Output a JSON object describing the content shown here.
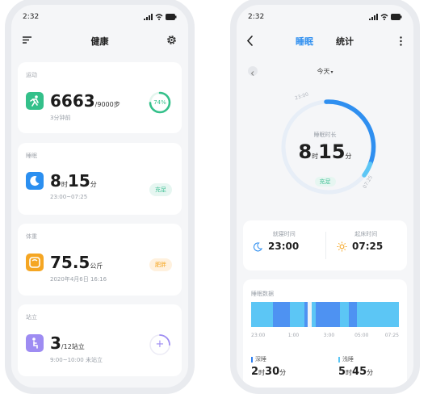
{
  "left_screen": {
    "status_time": "2:32",
    "title": "健康",
    "icons": {
      "menu": "filter-menu-icon",
      "settings": "gear-icon"
    },
    "exercise": {
      "category": "运动",
      "value": "6663",
      "unit": "/9000步",
      "sub": "3分钟前",
      "progress_label": "74%",
      "progress_fraction": 0.74,
      "color": "#34c08a"
    },
    "sleep": {
      "category": "睡眠",
      "hours": "8",
      "hours_unit": "时",
      "minutes": "15",
      "minutes_unit": "分",
      "sub": "23:00~07:25",
      "badge": "充足",
      "color": "#2b8ff0"
    },
    "weight": {
      "category": "体重",
      "value": "75.5",
      "unit": "公斤",
      "sub": "2020年4月6日 16:16",
      "badge": "肥胖",
      "color": "#f5a623"
    },
    "standing": {
      "category": "站立",
      "value": "3",
      "unit": "/12站立",
      "sub": "9:00~10:00 未站立",
      "add": "+",
      "progress_fraction": 0.25,
      "color": "#9e8cf2"
    }
  },
  "right_screen": {
    "status_time": "2:32",
    "tabs": {
      "active": "睡眠",
      "inactive": "统计"
    },
    "date_selector": "今天",
    "ring": {
      "label": "睡眠时长",
      "hours": "8",
      "hours_unit": "时",
      "minutes": "15",
      "minutes_unit": "分",
      "badge": "充足",
      "start_time": "23:00",
      "end_time": "07:25",
      "color": "#2f8ff0"
    },
    "bed_time": {
      "label": "就寝时间",
      "value": "23:00"
    },
    "wake_time": {
      "label": "起床时间",
      "value": "07:25"
    },
    "sleep_data": {
      "title": "睡眠数据",
      "axis": [
        "23:00",
        "1:00",
        "3:00",
        "05:00",
        "07:25"
      ],
      "deep": {
        "label": "深睡",
        "hours": "2",
        "minutes": "30",
        "hours_unit": "时",
        "minutes_unit": "分",
        "color": "#2f7ff0"
      },
      "light": {
        "label": "浅睡",
        "hours": "5",
        "minutes": "45",
        "hours_unit": "时",
        "minutes_unit": "分",
        "color": "#5cc6f5"
      }
    }
  }
}
